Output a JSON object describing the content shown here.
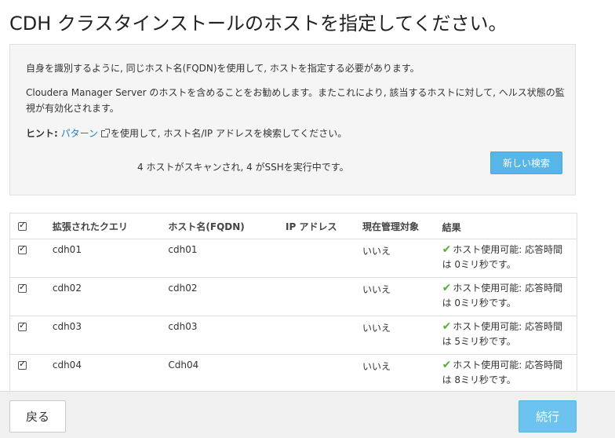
{
  "page": {
    "title": "CDH クラスタインストールのホストを指定してください。"
  },
  "info": {
    "line1": "自身を識別するように, 同じホスト名(FQDN)を使用して, ホストを指定する必要があります。",
    "line2": "Cloudera Manager Server のホストを含めることをお勧めします。またこれにより, 該当するホストに対して, ヘルス状態の監視が有効化されます。",
    "hint_label": "ヒント:",
    "hint_link": "パターン",
    "hint_rest": "を使用して, ホスト名/IP アドレスを検索してください。",
    "scan_status": "4 ホストがスキャンされ, 4 がSSHを実行中です。",
    "new_search_label": "新しい検索"
  },
  "table": {
    "headers": {
      "query": "拡張されたクエリ",
      "host": "ホスト名(FQDN)",
      "ip": "IP アドレス",
      "managed": "現在管理対象",
      "result": "結果"
    },
    "rows": [
      {
        "query": "cdh01",
        "host": "cdh01",
        "managed": "いいえ",
        "result_line1": "ホスト使用可能: 応答時間",
        "result_line2": "は 0ミリ秒です。"
      },
      {
        "query": "cdh02",
        "host": "cdh02",
        "managed": "いいえ",
        "result_line1": "ホスト使用可能: 応答時間",
        "result_line2": "は 0ミリ秒です。"
      },
      {
        "query": "cdh03",
        "host": "cdh03",
        "managed": "いいえ",
        "result_line1": "ホスト使用可能: 応答時間",
        "result_line2": "は 5ミリ秒です。"
      },
      {
        "query": "cdh04",
        "host": "Cdh04",
        "managed": "いいえ",
        "result_line1": "ホスト使用可能: 応答時間",
        "result_line2": "は 8ミリ秒です。"
      }
    ]
  },
  "footer": {
    "back_label": "戻る",
    "continue_label": "続行"
  },
  "colors": {
    "accent": "#57b5e8",
    "success": "#5aac3b",
    "link": "#1a7dc0"
  },
  "icons": {
    "external_link": "external-link-icon",
    "check_ok": "check-icon",
    "checkbox": "checkbox-checked"
  }
}
